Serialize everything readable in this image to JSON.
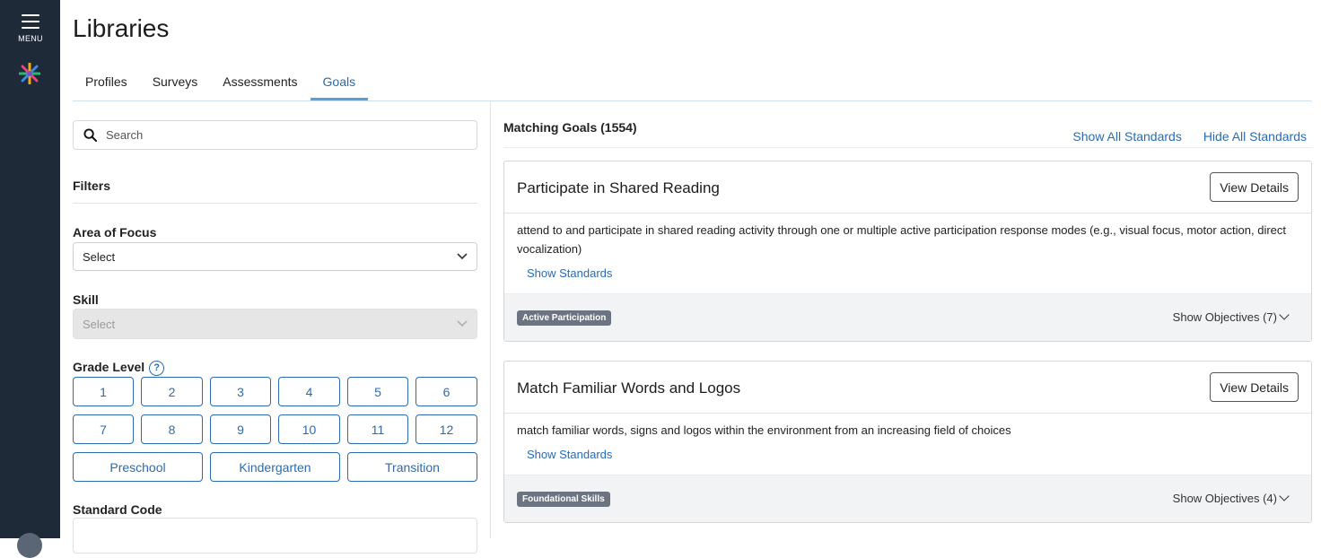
{
  "sidebar": {
    "menu_label": "MENU",
    "menu_icon": "hamburger-icon",
    "logo_icon": "app-logo-icon"
  },
  "header": {
    "title": "Libraries"
  },
  "tabs": [
    {
      "label": "Profiles",
      "active": false
    },
    {
      "label": "Surveys",
      "active": false
    },
    {
      "label": "Assessments",
      "active": false
    },
    {
      "label": "Goals",
      "active": true
    }
  ],
  "filters_panel": {
    "search": {
      "placeholder": "Search",
      "value": ""
    },
    "title": "Filters",
    "area_of_focus": {
      "label": "Area of Focus",
      "value": "Select"
    },
    "skill": {
      "label": "Skill",
      "value": "Select",
      "disabled": true
    },
    "grade_level": {
      "label": "Grade Level",
      "help_icon": "question-circle-icon",
      "buttons": [
        "1",
        "2",
        "3",
        "4",
        "5",
        "6",
        "7",
        "8",
        "9",
        "10",
        "11",
        "12"
      ],
      "wide_buttons": [
        "Preschool",
        "Kindergarten",
        "Transition"
      ]
    },
    "standard_code": {
      "label": "Standard Code",
      "value": ""
    }
  },
  "results": {
    "matching_label": "Matching Goals (1554)",
    "show_all_standards": "Show All Standards",
    "hide_all_standards": "Hide All Standards",
    "goals": [
      {
        "title": "Participate in Shared Reading",
        "view_details": "View Details",
        "description": "attend to and participate in shared reading activity through one or multiple active participation response modes (e.g., visual focus, motor action, direct vocalization)",
        "show_standards": "Show Standards",
        "badge": "Active Participation",
        "objectives": "Show Objectives (7)"
      },
      {
        "title": "Match Familiar Words and Logos",
        "view_details": "View Details",
        "description": "match familiar words, signs and logos within the environment from an increasing field of choices",
        "show_standards": "Show Standards",
        "badge": "Foundational Skills",
        "objectives": "Show Objectives (4)"
      }
    ]
  },
  "colors": {
    "sidebar_bg": "#1e2a38",
    "link": "#2b6cb0",
    "badge_bg": "#6b7480",
    "footer_bg": "#f2f3f5"
  }
}
